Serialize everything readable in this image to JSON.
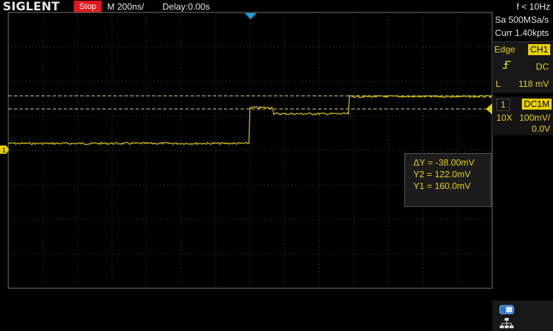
{
  "header": {
    "brand": "SIGLENT",
    "run_state": "Stop",
    "timebase": "M 200ns/",
    "delay": "Delay:0.00s",
    "frequency": "f < 10Hz",
    "sample_rate": "Sa 500MSa/s",
    "memory": "Curr 1.40kpts"
  },
  "trigger": {
    "type": "Edge",
    "source": "CH1",
    "slope_icon": "rising-edge-icon",
    "coupling": "DC",
    "level_label": "L",
    "level_value": "118 mV"
  },
  "channel": {
    "number": "1",
    "coupling": "DC1M",
    "probe": "10X",
    "scale": "100mV/",
    "offset": "0.0V"
  },
  "cursors": {
    "delta": "ΔY = -38.00mV",
    "y2": "Y2 = 122.0mV",
    "y1": "Y1 = 160.0mV"
  },
  "markers": {
    "channel_marker": "1",
    "trigger_level_marker": "trigger-level-arrow-icon",
    "trigger_position_marker": "trigger-position-arrow-icon"
  },
  "icons": [
    "toggle-icon",
    "network-icon"
  ],
  "colors": {
    "channel1": "#e8d000",
    "stop_badge": "#e0181b",
    "trigger_position": "#19a0e0"
  }
}
